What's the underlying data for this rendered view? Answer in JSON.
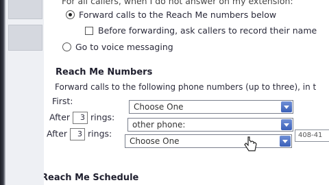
{
  "forwarding": {
    "intro_text": "For all callers, when I do not answer on my extension:",
    "option_forward": "Forward calls to the Reach Me numbers below",
    "option_ask_record": "Before forwarding, ask callers to record their name",
    "option_voice": "Go to voice messaging"
  },
  "reach_me": {
    "heading": "Reach Me Numbers",
    "description": "Forward calls to the following phone numbers (up to three), in t",
    "first_label": "First:",
    "first_select": "Choose One",
    "after_label": "After",
    "rings_label": "rings:",
    "row2_rings": "3",
    "row2_select": "other phone:",
    "row2_phone": "408-41",
    "row3_rings": "3",
    "row3_select": "Choose One"
  },
  "schedule": {
    "heading": "Reach Me Schedule"
  },
  "colors": {
    "dropdown_arrow": "#3a5fb8",
    "text": "#2a2a3a"
  }
}
